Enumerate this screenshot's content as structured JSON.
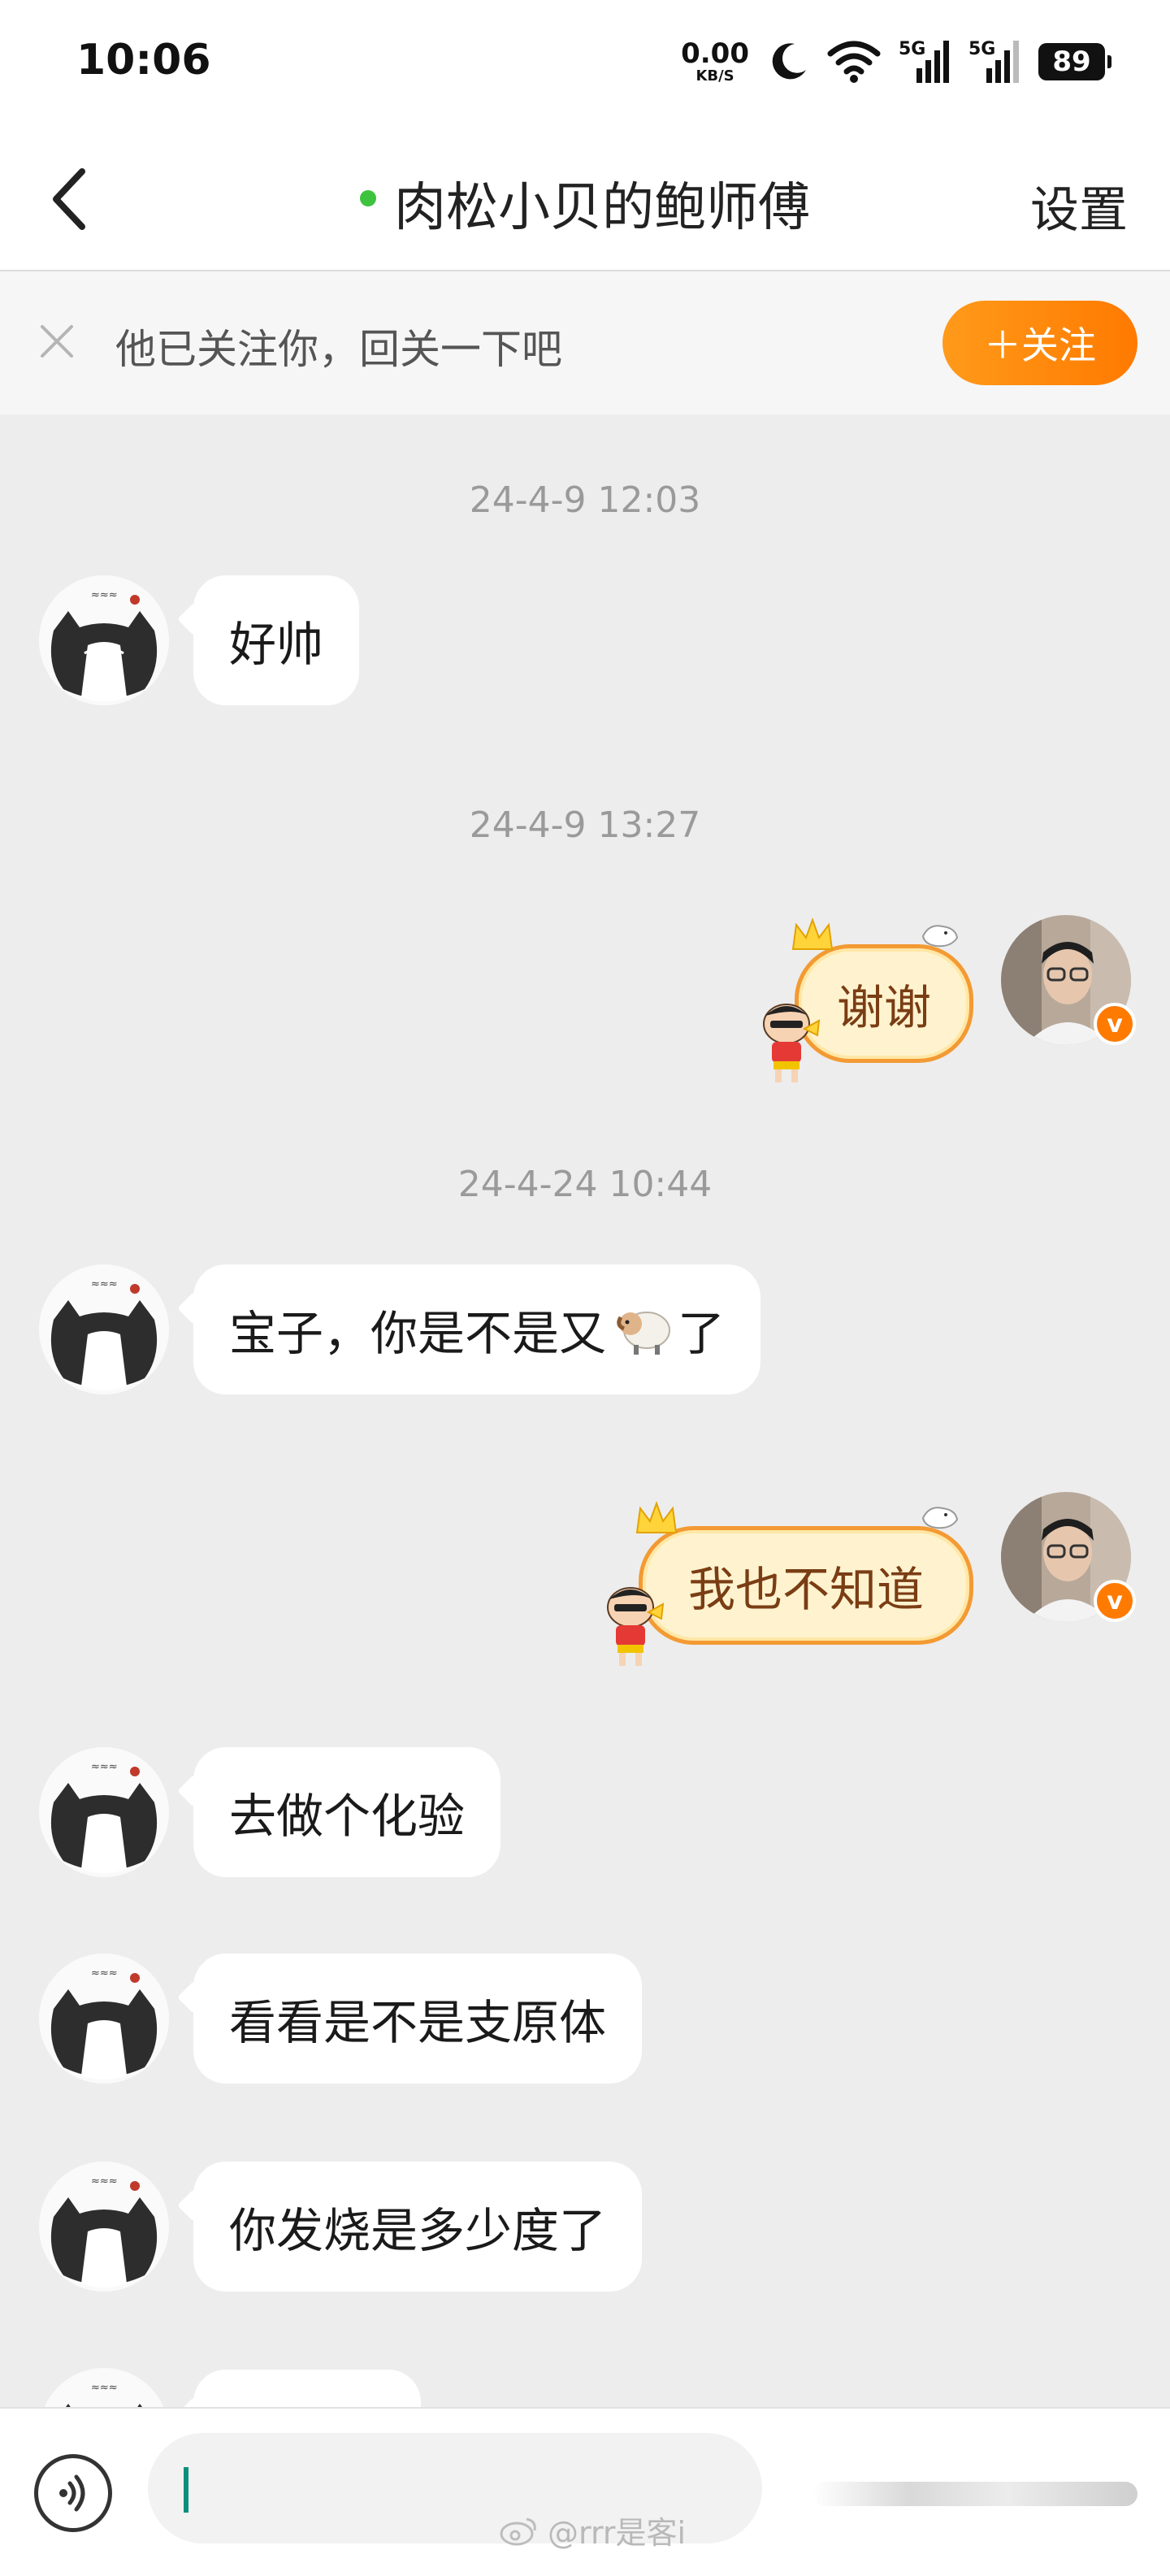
{
  "status_bar": {
    "time": "10:06",
    "net_speed": "0.00",
    "net_unit": "KB/S",
    "signal1": "5G",
    "signal2": "5G",
    "battery": "89"
  },
  "header": {
    "title": "肉松小贝的鲍师傅",
    "settings_label": "设置",
    "online_color": "#3ec33e"
  },
  "banner": {
    "text": "他已关注你，回关一下吧",
    "follow_label": "＋关注",
    "accent": "#ff8a00"
  },
  "messages": [
    {
      "timestamp": "24-4-9 12:03"
    },
    {
      "side": "in",
      "text": "好帅"
    },
    {
      "timestamp": "24-4-9 13:27"
    },
    {
      "side": "out",
      "text": "谢谢"
    },
    {
      "timestamp": "24-4-24 10:44"
    },
    {
      "side": "in",
      "text_before": "宝子，你是不是又",
      "emoji": "sheep",
      "text_after": "了"
    },
    {
      "side": "out",
      "text": "我也不知道"
    },
    {
      "side": "in",
      "text": "去做个化验"
    },
    {
      "side": "in",
      "text": "看看是不是支原体"
    },
    {
      "side": "in",
      "text": "你发烧是多少度了"
    }
  ],
  "input_bar": {
    "watermark": "@rrr是客i"
  }
}
